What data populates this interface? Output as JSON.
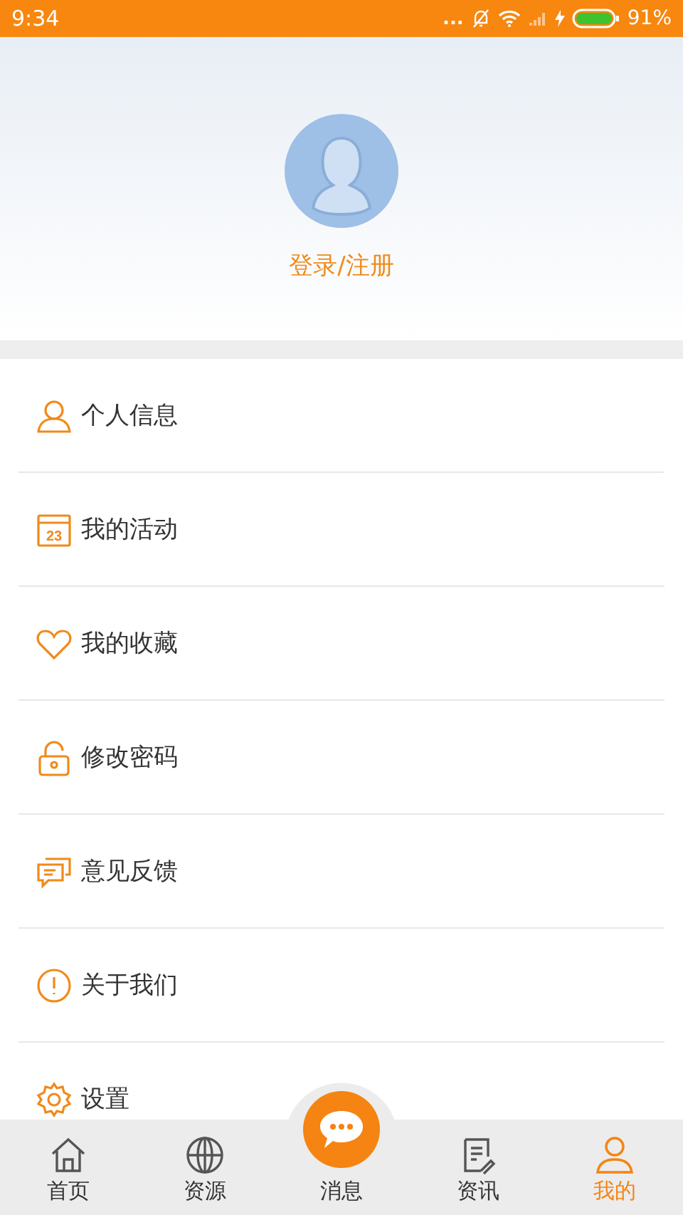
{
  "status_bar": {
    "time": "9:34",
    "dots": "...",
    "battery": "91%"
  },
  "profile": {
    "login_link": "登录/注册"
  },
  "menu": [
    {
      "label": "个人信息"
    },
    {
      "label": "我的活动",
      "icon_text": "23"
    },
    {
      "label": "我的收藏"
    },
    {
      "label": "修改密码"
    },
    {
      "label": "意见反馈"
    },
    {
      "label": "关于我们"
    },
    {
      "label": "设置"
    }
  ],
  "tabs": [
    {
      "label": "首页",
      "kind": "normal",
      "selected": false
    },
    {
      "label": "资源",
      "kind": "normal",
      "selected": false
    },
    {
      "label": "消息",
      "kind": "center",
      "selected": false
    },
    {
      "label": "资讯",
      "kind": "normal",
      "selected": false
    },
    {
      "label": "我的",
      "kind": "normal",
      "selected": true
    }
  ]
}
